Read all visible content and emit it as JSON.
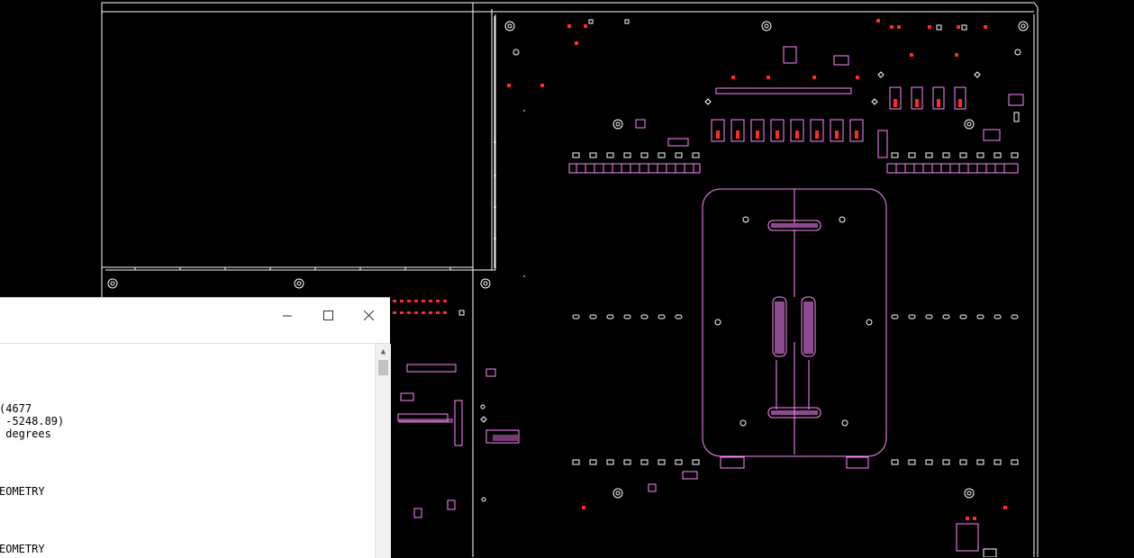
{
  "viewer": {
    "canvas_background": "#000000",
    "outline_color": "#ffffff",
    "component_color": "#ff88ff",
    "pad_color": "#ff0000"
  },
  "console_window": {
    "controls": {
      "minimize_icon": "window-minimize-icon",
      "maximize_icon": "window-maximize-icon",
      "close_icon": "window-close-icon"
    },
    "lines": [
      "(4677",
      " -5248.89)",
      " degrees",
      "EOMETRY",
      "EOMETRY"
    ]
  }
}
